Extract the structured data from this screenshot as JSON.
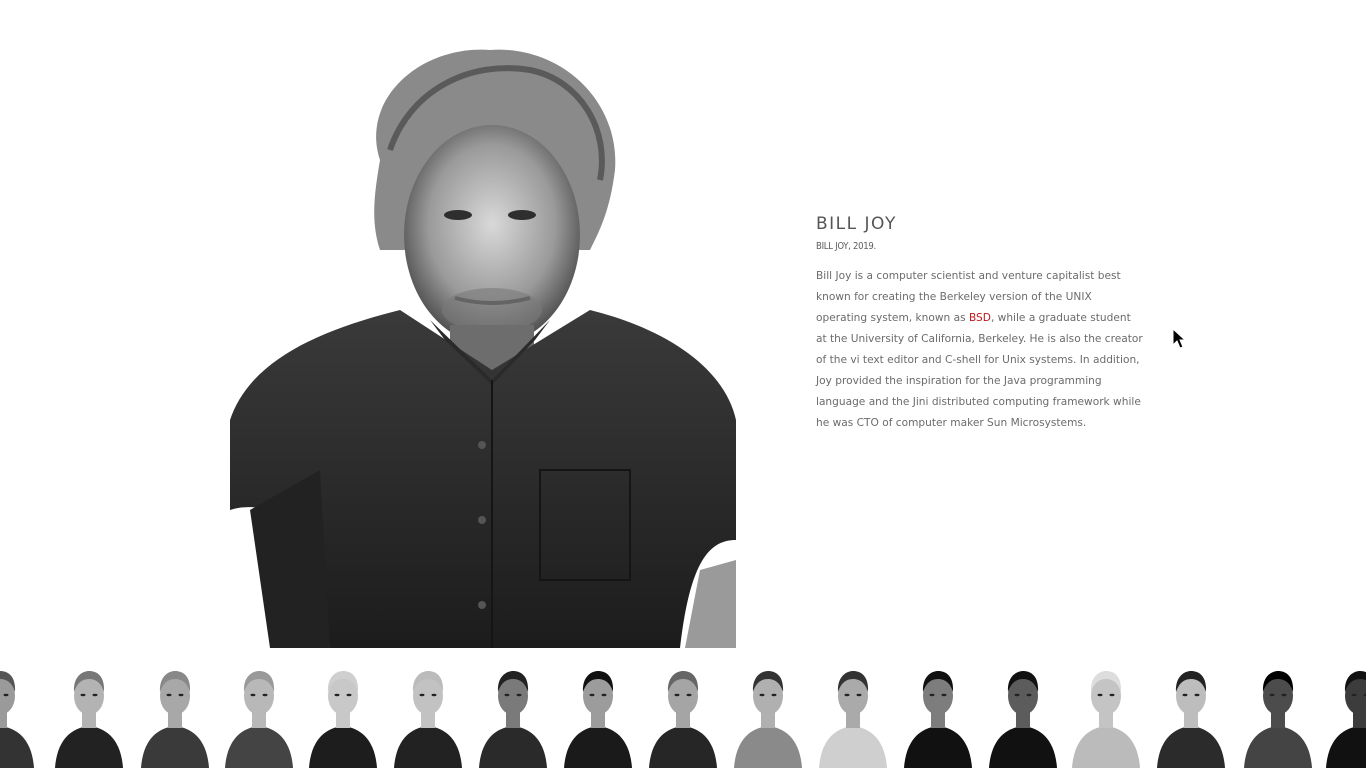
{
  "person": {
    "name": "BILL JOY",
    "caption": "BILL JOY, 2019.",
    "bio_before_link": "Bill Joy is a computer scientist and venture capitalist best known for creating the Berkeley version of the UNIX operating system, known as ",
    "bio_link": "BSD",
    "bio_after_link": ", while a graduate student at the University of California, Berkeley. He is also the creator of the vi text editor and C-shell for Unix systems. In addition, Joy provided the inspiration for the Java programming language and the Jini distributed computing framework while he was CTO of computer maker Sun Microsystems."
  },
  "colors": {
    "link": "#c0161a",
    "heading": "#555555",
    "body_text": "#6b6b6b"
  },
  "thumbnails": {
    "count": 17,
    "style": "black-and-white portraits"
  }
}
